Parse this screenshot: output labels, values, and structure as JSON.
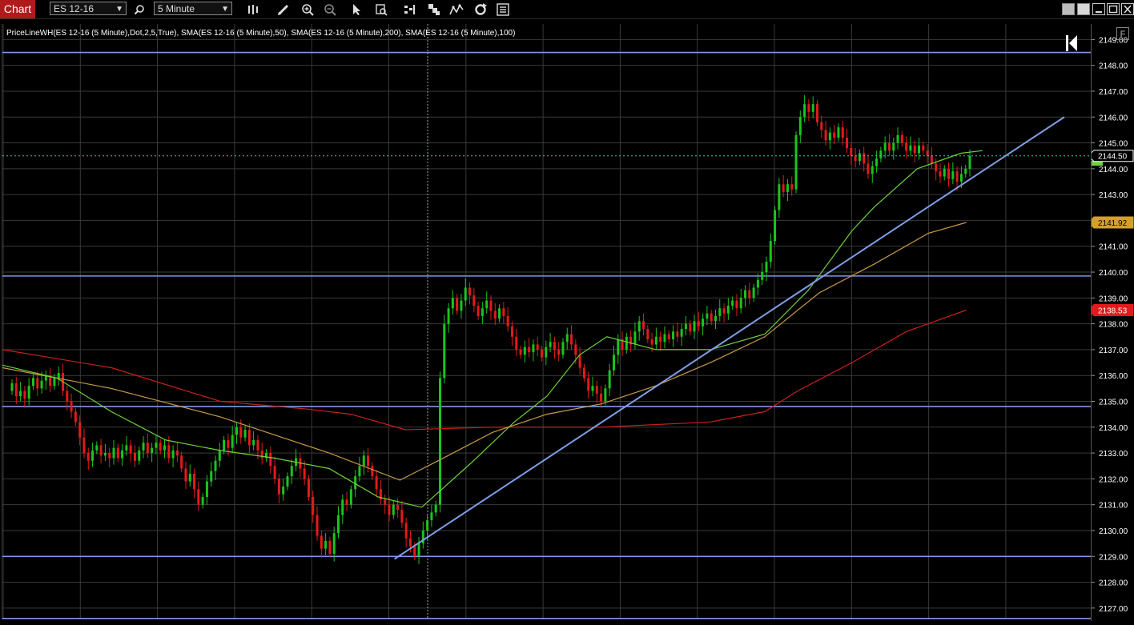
{
  "toolbar": {
    "app_tab": "Chart",
    "symbol": "ES 12-16",
    "interval": "5 Minute"
  },
  "indicator_title": "PriceLineWH(ES 12-16 (5 Minute),Dot,2,5,True), SMA(ES 12-16 (5 Minute),50), SMA(ES 12-16 (5 Minute),200), SMA(ES 12-16 (5 Minute),100)",
  "f_button": "F",
  "price_axis": {
    "ticks": [
      2149,
      2148,
      2147,
      2146,
      2145,
      2144,
      2143,
      2142,
      2141,
      2140,
      2139,
      2138,
      2137,
      2136,
      2135,
      2134,
      2133,
      2132,
      2131,
      2130,
      2129,
      2128,
      2127
    ],
    "ymin": 2126.5,
    "ymax": 2149.6
  },
  "price_tags": [
    {
      "label": "2144.50",
      "value": 2144.5,
      "color": "#000000",
      "text": "#ffffff",
      "border": "#ffffff"
    },
    {
      "label": "2141.92",
      "value": 2141.92,
      "color": "#d4a02a",
      "text": "#000000",
      "border": "#d4a02a"
    },
    {
      "label": "2138.53",
      "value": 2138.53,
      "color": "#e11b1b",
      "text": "#ffffff",
      "border": "#e11b1b"
    }
  ],
  "colors": {
    "up": "#19c51c",
    "down": "#e11b1b",
    "grid": "#3a3a3a",
    "hline": "#7f97e6",
    "sma50": "#6ed23a",
    "sma100": "#c79a4a",
    "sma200": "#c8211c",
    "priceline": "#35c9b4"
  },
  "horizontal_lines": [
    2148.5,
    2139.85,
    2134.8,
    2129.0,
    2126.6
  ],
  "trendline": {
    "x0": 0.36,
    "y0": 2128.9,
    "x1": 0.975,
    "y1": 2146.0
  },
  "current_price": 2144.5,
  "chart_data": {
    "type": "candlestick",
    "x_count": 240,
    "closes": [
      2135.7,
      2135.2,
      2135.4,
      2135.1,
      2135.6,
      2135.9,
      2135.5,
      2135.8,
      2136.0,
      2135.6,
      2135.9,
      2136.1,
      2135.4,
      2135.0,
      2134.6,
      2134.2,
      2133.6,
      2133.0,
      2132.7,
      2133.1,
      2133.3,
      2132.9,
      2133.0,
      2132.8,
      2133.2,
      2132.8,
      2133.1,
      2133.3,
      2133.0,
      2132.7,
      2133.1,
      2133.4,
      2133.0,
      2133.2,
      2133.4,
      2133.1,
      2133.3,
      2132.8,
      2133.1,
      2132.9,
      2132.4,
      2131.9,
      2132.2,
      2131.6,
      2131.0,
      2131.3,
      2131.9,
      2132.3,
      2132.7,
      2133.1,
      2133.5,
      2133.2,
      2133.7,
      2134.0,
      2133.6,
      2133.9,
      2133.3,
      2133.5,
      2133.1,
      2132.8,
      2133.0,
      2132.5,
      2132.0,
      2131.4,
      2131.7,
      2132.1,
      2132.5,
      2132.8,
      2132.4,
      2132.0,
      2131.3,
      2130.6,
      2129.8,
      2129.3,
      2129.6,
      2129.1,
      2129.9,
      2130.6,
      2131.2,
      2131.0,
      2131.6,
      2132.1,
      2132.5,
      2132.9,
      2132.5,
      2132.1,
      2131.6,
      2131.2,
      2131.0,
      2130.6,
      2131.0,
      2130.8,
      2130.3,
      2129.7,
      2129.4,
      2129.0,
      2129.5,
      2130.0,
      2130.4,
      2130.7,
      2131.0,
      2135.9,
      2138.0,
      2138.6,
      2139.0,
      2138.5,
      2138.9,
      2139.4,
      2139.1,
      2138.7,
      2138.3,
      2138.6,
      2138.9,
      2138.5,
      2138.2,
      2138.6,
      2138.3,
      2137.9,
      2137.5,
      2137.0,
      2136.8,
      2137.1,
      2136.9,
      2137.2,
      2137.0,
      2136.7,
      2137.1,
      2137.3,
      2137.0,
      2136.8,
      2137.3,
      2137.6,
      2137.2,
      2136.8,
      2136.3,
      2135.9,
      2135.4,
      2135.6,
      2135.3,
      2135.0,
      2135.5,
      2136.2,
      2136.8,
      2137.4,
      2137.0,
      2137.5,
      2137.2,
      2137.7,
      2138.1,
      2137.8,
      2137.4,
      2137.2,
      2137.5,
      2137.3,
      2137.6,
      2137.4,
      2137.7,
      2137.5,
      2137.8,
      2138.0,
      2137.7,
      2138.1,
      2137.9,
      2138.2,
      2138.4,
      2138.1,
      2138.3,
      2138.6,
      2138.4,
      2138.7,
      2138.9,
      2138.6,
      2139.0,
      2139.3,
      2139.0,
      2139.4,
      2139.7,
      2140.0,
      2140.4,
      2141.2,
      2142.4,
      2143.4,
      2143.1,
      2143.4,
      2143.2,
      2145.3,
      2146.0,
      2146.5,
      2146.2,
      2146.5,
      2145.8,
      2145.5,
      2145.1,
      2145.4,
      2145.2,
      2145.6,
      2145.2,
      2144.8,
      2144.5,
      2144.3,
      2144.6,
      2144.2,
      2143.8,
      2144.1,
      2144.4,
      2144.7,
      2145.0,
      2144.7,
      2145.0,
      2145.3,
      2145.0,
      2144.7,
      2144.9,
      2144.6,
      2144.9,
      2144.7,
      2144.5,
      2144.2,
      2143.9,
      2143.7,
      2144.0,
      2143.6,
      2143.9,
      2143.5,
      2143.8,
      2144.0,
      2144.5
    ],
    "sma50": [
      [
        0,
        2136.4
      ],
      [
        0.05,
        2135.9
      ],
      [
        0.1,
        2134.6
      ],
      [
        0.15,
        2133.5
      ],
      [
        0.2,
        2133.1
      ],
      [
        0.25,
        2132.8
      ],
      [
        0.3,
        2132.4
      ],
      [
        0.345,
        2131.3
      ],
      [
        0.385,
        2130.9
      ],
      [
        0.43,
        2132.6
      ],
      [
        0.47,
        2134.2
      ],
      [
        0.5,
        2135.2
      ],
      [
        0.53,
        2136.8
      ],
      [
        0.555,
        2137.5
      ],
      [
        0.6,
        2137.0
      ],
      [
        0.65,
        2137.0
      ],
      [
        0.7,
        2137.6
      ],
      [
        0.74,
        2139.3
      ],
      [
        0.78,
        2141.6
      ],
      [
        0.8,
        2142.5
      ],
      [
        0.84,
        2144.0
      ],
      [
        0.88,
        2144.6
      ],
      [
        0.9,
        2144.7
      ]
    ],
    "sma100": [
      [
        0,
        2136.3
      ],
      [
        0.1,
        2135.5
      ],
      [
        0.2,
        2134.4
      ],
      [
        0.3,
        2133.0
      ],
      [
        0.365,
        2131.95
      ],
      [
        0.4,
        2132.7
      ],
      [
        0.45,
        2133.8
      ],
      [
        0.5,
        2134.5
      ],
      [
        0.55,
        2134.9
      ],
      [
        0.6,
        2135.6
      ],
      [
        0.65,
        2136.5
      ],
      [
        0.7,
        2137.5
      ],
      [
        0.75,
        2139.2
      ],
      [
        0.8,
        2140.3
      ],
      [
        0.85,
        2141.5
      ],
      [
        0.885,
        2141.92
      ]
    ],
    "sma200": [
      [
        0,
        2137.0
      ],
      [
        0.1,
        2136.3
      ],
      [
        0.2,
        2135.0
      ],
      [
        0.28,
        2134.7
      ],
      [
        0.32,
        2134.5
      ],
      [
        0.37,
        2133.9
      ],
      [
        0.45,
        2134.0
      ],
      [
        0.55,
        2134.0
      ],
      [
        0.65,
        2134.2
      ],
      [
        0.7,
        2134.6
      ],
      [
        0.73,
        2135.4
      ],
      [
        0.78,
        2136.5
      ],
      [
        0.83,
        2137.7
      ],
      [
        0.885,
        2138.53
      ]
    ]
  }
}
